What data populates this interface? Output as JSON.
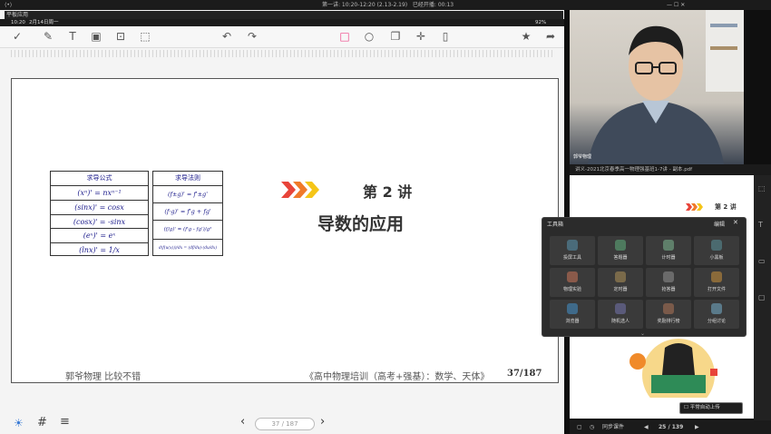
{
  "system_bar": {
    "left_icon": "⟨•⟩",
    "course_info": "第一讲: 10:20-12:20 (2.13-2.19)",
    "elapsed": "已经开播: 00:13",
    "window_controls": "— ☐ ✕"
  },
  "app": {
    "name": "平板应用"
  },
  "status": {
    "time": "10:20",
    "date": "2月14日周一",
    "battery": "92%"
  },
  "toolbar": {
    "icons": [
      "check-circle-icon",
      "eraser-icon",
      "text-icon",
      "image-icon",
      "shapes-icon",
      "select-icon",
      "undo-icon",
      "redo-icon",
      "rectangle-icon",
      "circle-icon",
      "copy-icon",
      "move-icon",
      "clipboard-icon",
      "star-icon",
      "share-icon"
    ]
  },
  "slide": {
    "table1": {
      "header": "求导公式",
      "rows": [
        "(xⁿ)' = nxⁿ⁻¹",
        "(sinx)' = cosx",
        "(cosx)' = -sinx",
        "(eˣ)' = eˣ",
        "(lnx)' = 1/x"
      ]
    },
    "table2": {
      "header": "求导法则",
      "rows": [
        "(f±g)' = f'±g'",
        "(f·g)' = f'g + fg'",
        "(f/g)' = (f'g - fg')/g²",
        "d(f(u(x)))/dx = (df/du)·(du/dx)"
      ]
    },
    "lecture_title": "第 2 讲",
    "lecture_subtitle": "导数的应用",
    "footer_left": "郭爷物理  比较不错",
    "footer_right": "《高中物理培训（高考+强基）：数学、天体》",
    "footer_page": "37/187"
  },
  "pager": {
    "text": "37 / 187"
  },
  "right_panel": {
    "watermark": "郭爷物理",
    "pdf_title": "讲义-2021北京春季高一物理强基班1-7讲 - 副本.pdf",
    "pdf_page_title": "第 2 讲",
    "page_indicator": "25 / 139",
    "sync_label": "平常自动上传",
    "bottom_label": "同步课件"
  },
  "toolbox": {
    "title": "工具箱",
    "edit": "编辑",
    "tools": [
      {
        "label": "投屏工具",
        "icon": "screen-icon"
      },
      {
        "label": "答题器",
        "icon": "answer-icon"
      },
      {
        "label": "计时器",
        "icon": "timer-icon"
      },
      {
        "label": "小黑板",
        "icon": "board-icon"
      },
      {
        "label": "物理实验",
        "icon": "magnet-icon"
      },
      {
        "label": "定时器",
        "icon": "hourglass-icon"
      },
      {
        "label": "抢答器",
        "icon": "buzzer-icon"
      },
      {
        "label": "打开文件",
        "icon": "folder-icon"
      },
      {
        "label": "浏览器",
        "icon": "browser-icon"
      },
      {
        "label": "随机选人",
        "icon": "random-icon"
      },
      {
        "label": "奖励排行榜",
        "icon": "ranking-icon"
      },
      {
        "label": "分组讨论",
        "icon": "group-icon"
      }
    ]
  }
}
